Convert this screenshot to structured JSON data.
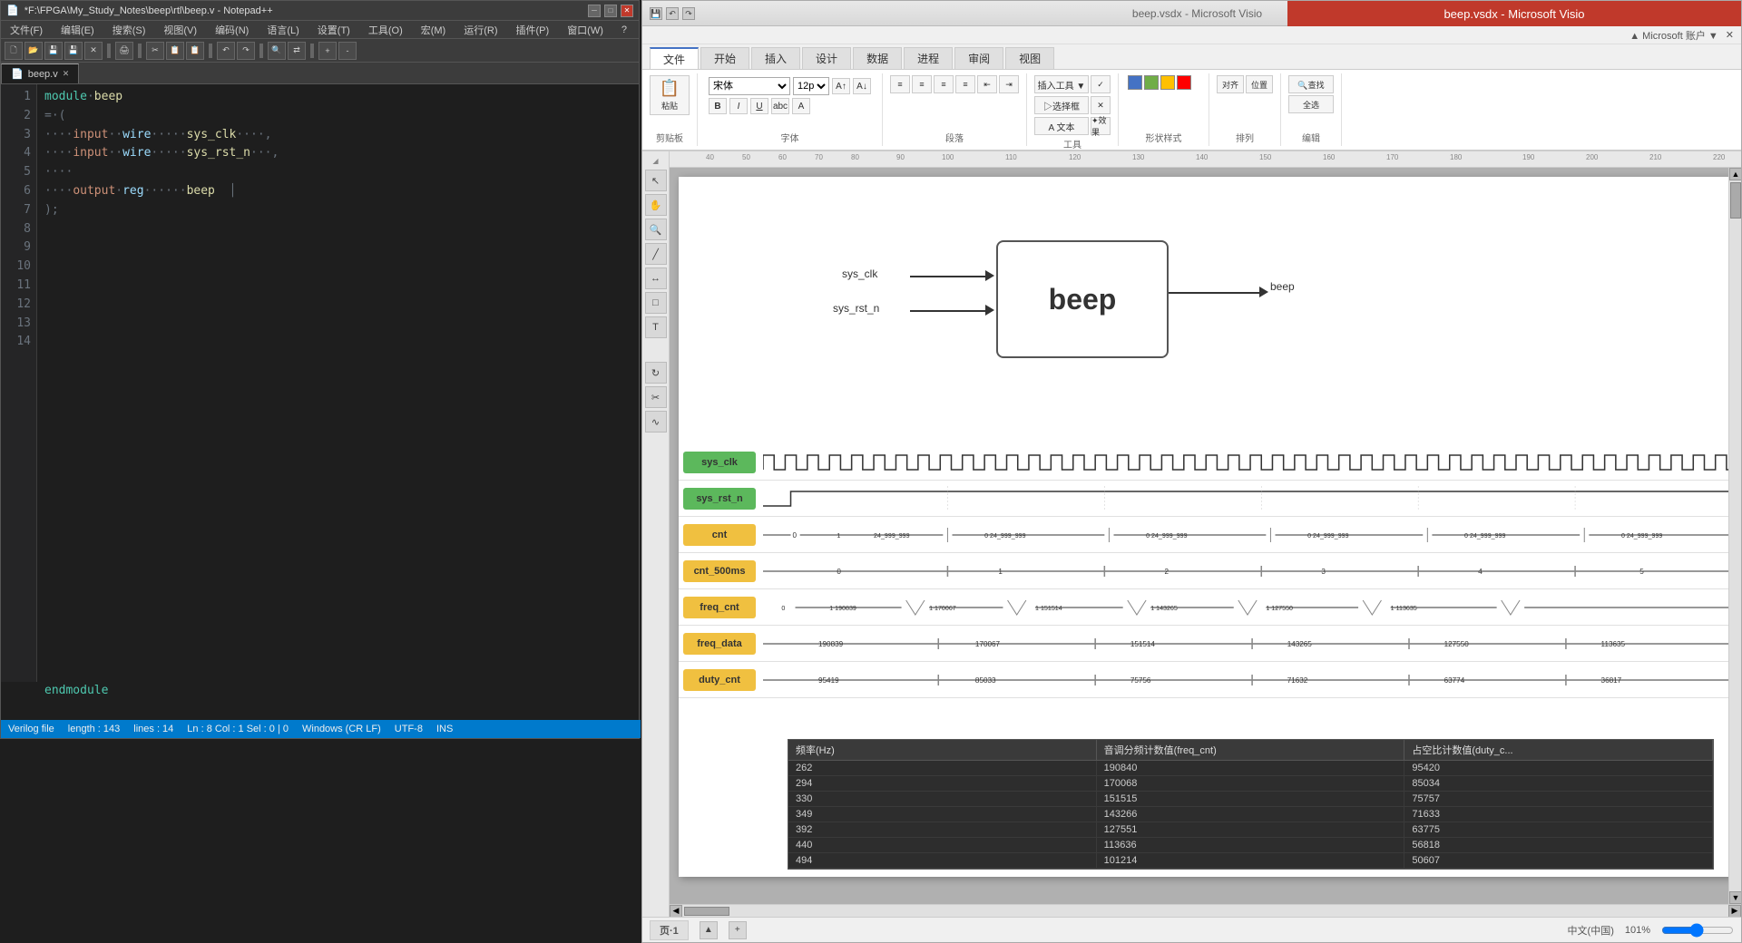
{
  "notepad": {
    "title": "*F:\\FPGA\\My_Study_Notes\\beep\\rtl\\beep.v - Notepad++",
    "tab_label": "beep.v",
    "tab_icon": "🗋",
    "menu_items": [
      "文件(F)",
      "编辑(E)",
      "搜索(S)",
      "视图(V)",
      "编码(N)",
      "语言(L)",
      "设置(T)",
      "工具(O)",
      "宏(M)",
      "运行(R)",
      "插件(P)",
      "窗口(W)",
      "?"
    ],
    "code_lines": [
      {
        "num": "1",
        "text": "module beep"
      },
      {
        "num": "2",
        "text": "= ("
      },
      {
        "num": "3",
        "text": "····input··wire·····sys_clk····,"
      },
      {
        "num": "4",
        "text": "····input··wire·····sys_rst_n···,"
      },
      {
        "num": "5",
        "text": "····"
      },
      {
        "num": "6",
        "text": "····output·reg······beep"
      },
      {
        "num": "7",
        "text": ");"
      },
      {
        "num": "8",
        "text": ""
      },
      {
        "num": "9",
        "text": ""
      },
      {
        "num": "10",
        "text": ""
      },
      {
        "num": "11",
        "text": ""
      },
      {
        "num": "12",
        "text": ""
      },
      {
        "num": "13",
        "text": "endmodule"
      },
      {
        "num": "14",
        "text": ""
      }
    ],
    "status": {
      "file_type": "Verilog file",
      "length": "length : 143",
      "lines": "lines : 14",
      "position": "Ln : 8   Col : 1   Sel : 0 | 0",
      "os": "Windows (CR LF)",
      "encoding": "UTF-8",
      "mode": "INS"
    }
  },
  "visio": {
    "title": "beep.vsdx - Microsoft Visio",
    "redbar_text": "beep.vsdx - Microsoft Visio",
    "tabs": [
      "文件",
      "开始",
      "插入",
      "设计",
      "数据",
      "进程",
      "审阅",
      "视图"
    ],
    "active_tab": "文件",
    "ribbon": {
      "groups": [
        "粘贴",
        "字体",
        "段落",
        "工具",
        "形状样式",
        "排列",
        "编辑"
      ]
    },
    "diagram": {
      "block_label": "beep",
      "inputs": [
        "sys_clk",
        "sys_rst_n"
      ],
      "outputs": [
        "beep"
      ]
    },
    "waveforms": [
      {
        "label": "sys_clk",
        "color": "green",
        "type": "clock"
      },
      {
        "label": "sys_rst_n",
        "color": "green",
        "type": "rst"
      },
      {
        "label": "cnt",
        "color": "yellow",
        "type": "bus",
        "values": [
          "0",
          "1",
          "24_999_999",
          "0",
          "24_999_999",
          "0",
          "24_999_999",
          "0",
          "24_999_999",
          "0",
          "24_999_999"
        ]
      },
      {
        "label": "cnt_500ms",
        "color": "yellow",
        "type": "counter",
        "values": [
          "0",
          "1",
          "2",
          "3",
          "4",
          "5"
        ]
      },
      {
        "label": "freq_cnt",
        "color": "yellow",
        "type": "bus",
        "values": [
          "0",
          "1",
          "190839",
          "1",
          "170067",
          "1",
          "151514",
          "1",
          "143265",
          "1",
          "127550",
          "1",
          "113635"
        ]
      },
      {
        "label": "freq_data",
        "color": "yellow",
        "type": "flat",
        "values": [
          "190839",
          "170067",
          "151514",
          "143265",
          "127550",
          "113635"
        ]
      },
      {
        "label": "duty_cnt",
        "color": "yellow",
        "type": "flat",
        "values": [
          "95419",
          "85033",
          "75756",
          "71632",
          "63774",
          "36817"
        ]
      }
    ],
    "table": {
      "headers": [
        "频率(Hz)",
        "音调分频计数值(freq_cnt)",
        "占空比计数值(duty_c..."
      ],
      "rows": [
        [
          "262",
          "190840",
          "95420"
        ],
        [
          "294",
          "170068",
          "85034"
        ],
        [
          "330",
          "151515",
          "75757"
        ],
        [
          "349",
          "143266",
          "71633"
        ],
        [
          "392",
          "127551",
          "63775"
        ],
        [
          "440",
          "113636",
          "56818"
        ],
        [
          "494",
          "101214",
          "50607"
        ]
      ]
    },
    "bottom": {
      "page_label": "页·1",
      "zoom": "101%",
      "lang": "中文(中国)"
    }
  }
}
